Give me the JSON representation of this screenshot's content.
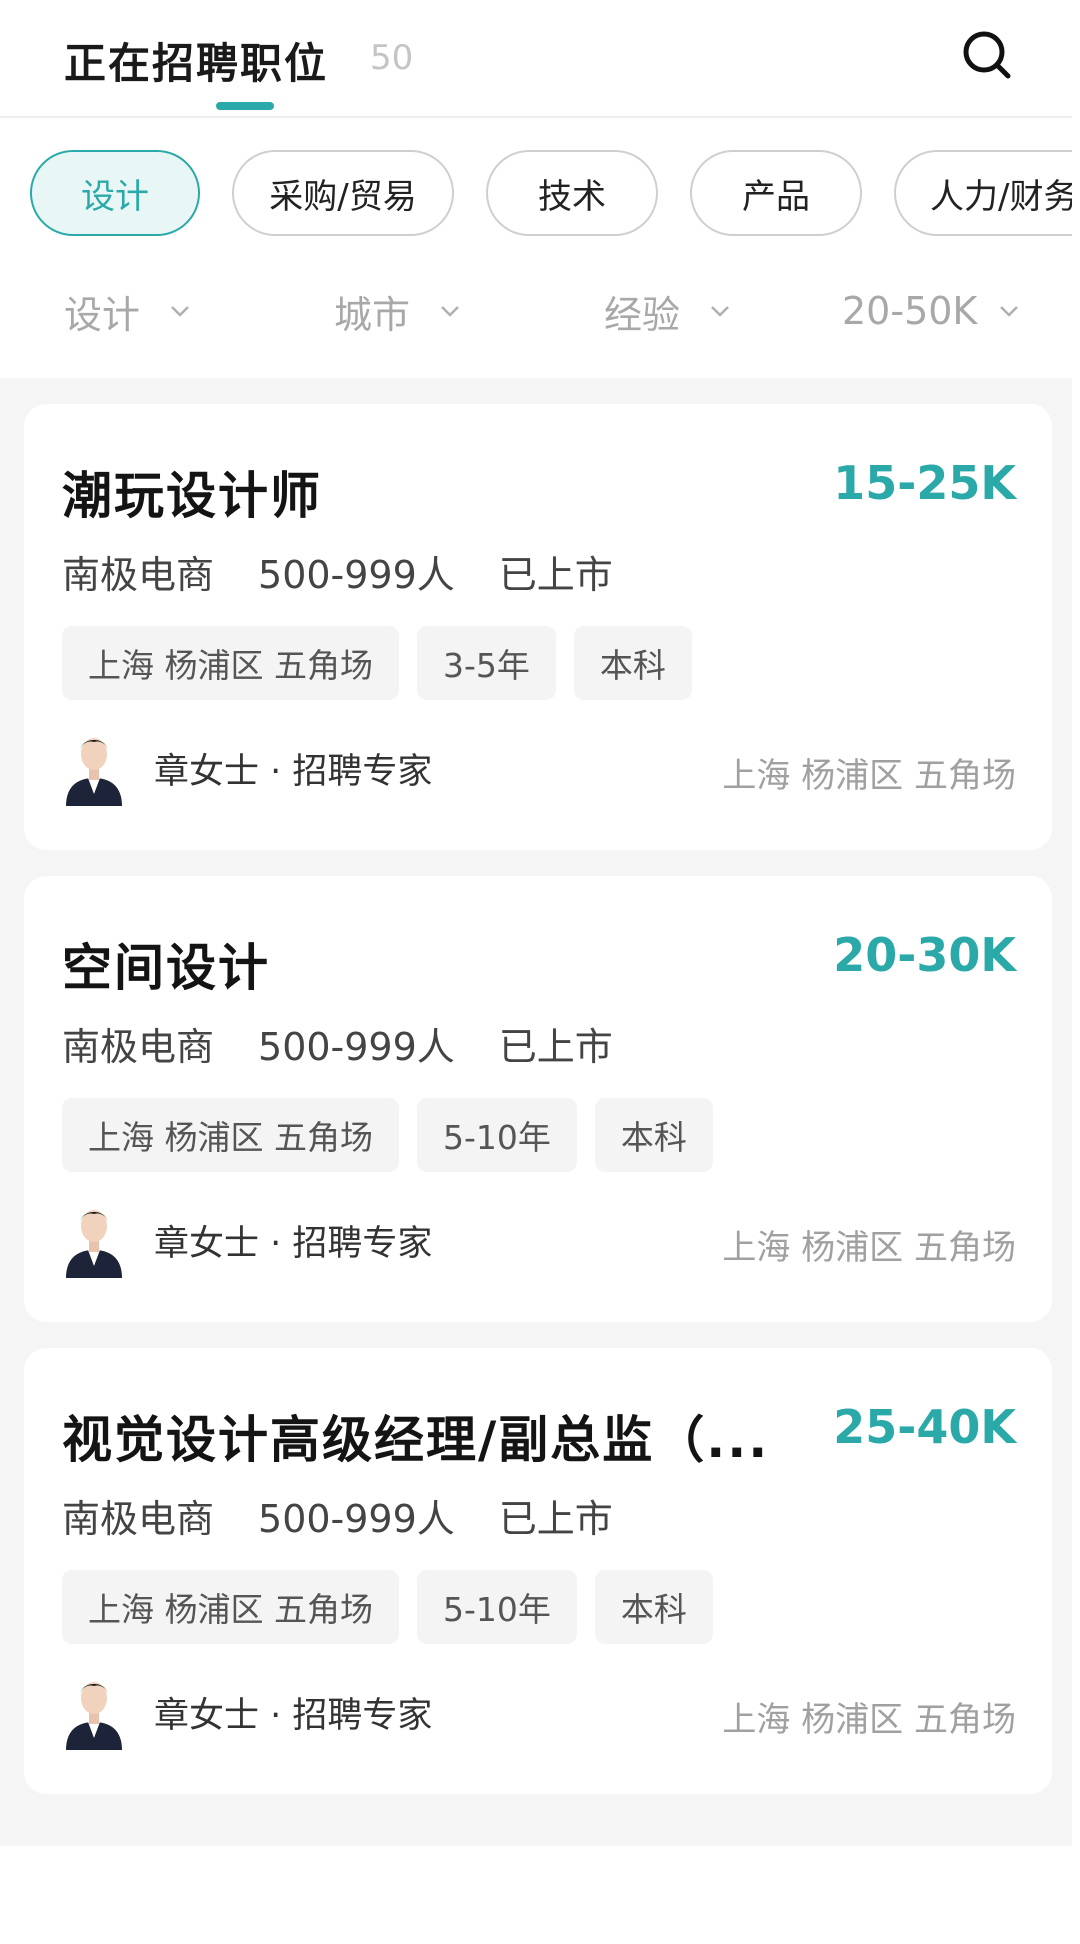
{
  "header": {
    "title": "正在招聘职位",
    "count": "50"
  },
  "categories": [
    "设计",
    "采购/贸易",
    "技术",
    "产品",
    "人力/财务"
  ],
  "filters": [
    "设计",
    "城市",
    "经验",
    "20-50K"
  ],
  "jobs": [
    {
      "title": "潮玩设计师",
      "salary": "15-25K",
      "company": "南极电商",
      "size": "500-999人",
      "stage": "已上市",
      "tags": [
        "上海 杨浦区 五角场",
        "3-5年",
        "本科"
      ],
      "recruiter": "章女士 · 招聘专家",
      "location": "上海 杨浦区 五角场"
    },
    {
      "title": "空间设计",
      "salary": "20-30K",
      "company": "南极电商",
      "size": "500-999人",
      "stage": "已上市",
      "tags": [
        "上海 杨浦区 五角场",
        "5-10年",
        "本科"
      ],
      "recruiter": "章女士 · 招聘专家",
      "location": "上海 杨浦区 五角场"
    },
    {
      "title": "视觉设计高级经理/副总监（...",
      "salary": "25-40K",
      "company": "南极电商",
      "size": "500-999人",
      "stage": "已上市",
      "tags": [
        "上海 杨浦区 五角场",
        "5-10年",
        "本科"
      ],
      "recruiter": "章女士 · 招聘专家",
      "location": "上海 杨浦区 五角场"
    }
  ],
  "icons": {
    "search": "search-icon",
    "dropdown": "chevron-down-icon",
    "avatar": "avatar"
  },
  "colors": {
    "accent": "#2aa9a8",
    "background": "#f5f5f5",
    "card": "#ffffff",
    "muted": "#a8a8a8"
  }
}
